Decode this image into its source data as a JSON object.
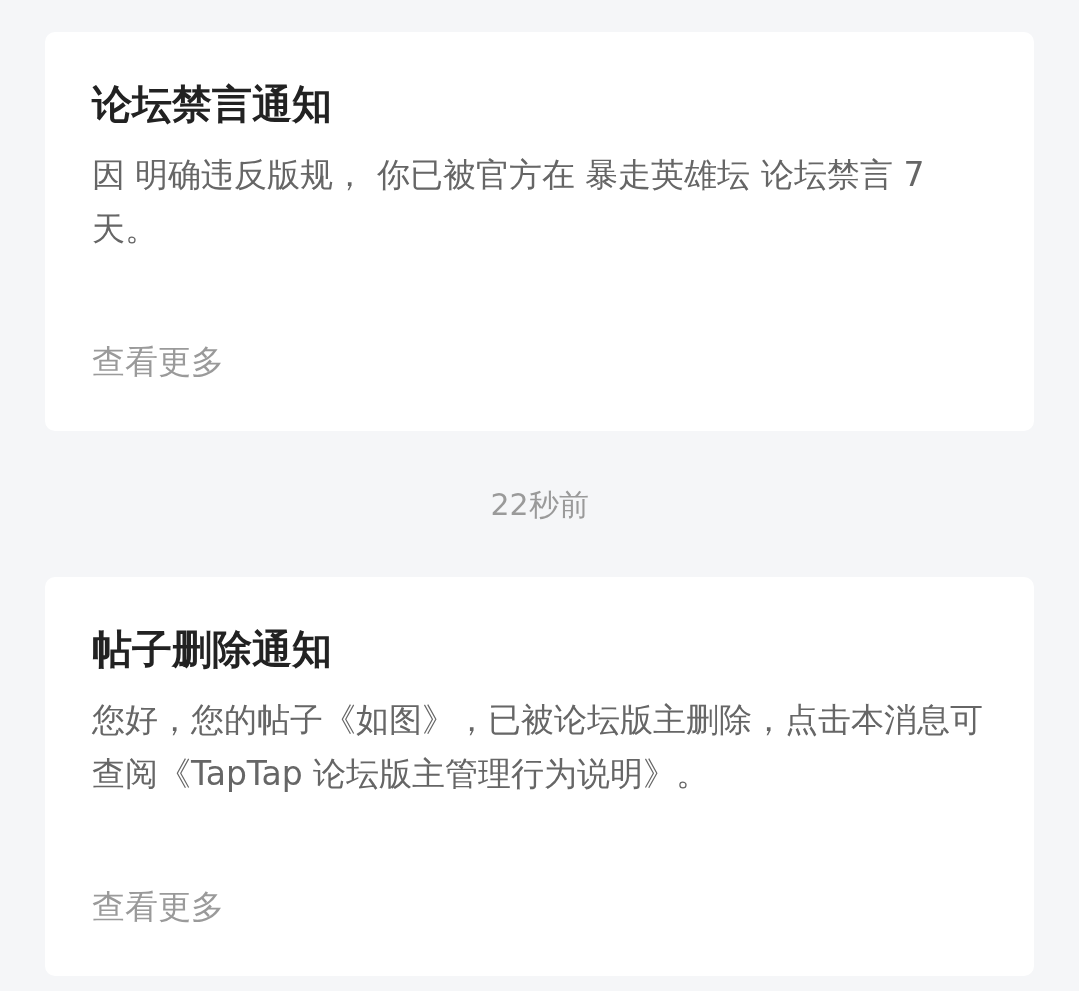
{
  "messages": [
    {
      "title": "论坛禁言通知",
      "body": "因 明确违反版规， 你已被官方在 暴走英雄坛 论坛禁言 7 天。",
      "more": "查看更多"
    },
    {
      "timestamp": "22秒前",
      "title": "帖子删除通知",
      "body": "您好，您的帖子《如图》，已被论坛版主删除，点击本消息可查阅《TapTap 论坛版主管理行为说明》。",
      "more": "查看更多"
    }
  ]
}
